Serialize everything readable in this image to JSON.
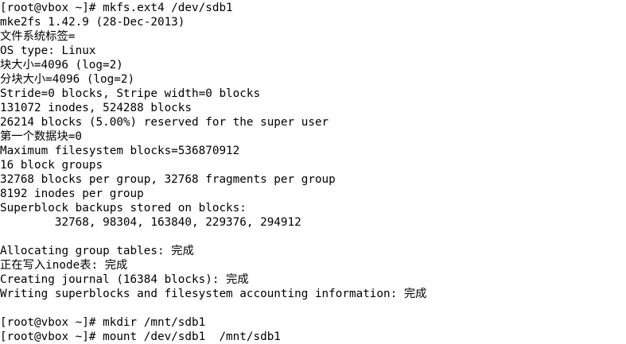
{
  "terminal": {
    "background": "#ffffff",
    "foreground": "#000000",
    "lines": [
      "[root@vbox ~]# mkfs.ext4 /dev/sdb1",
      "mke2fs 1.42.9 (28-Dec-2013)",
      "文件系统标签=",
      "OS type: Linux",
      "块大小=4096 (log=2)",
      "分块大小=4096 (log=2)",
      "Stride=0 blocks, Stripe width=0 blocks",
      "131072 inodes, 524288 blocks",
      "26214 blocks (5.00%) reserved for the super user",
      "第一个数据块=0",
      "Maximum filesystem blocks=536870912",
      "16 block groups",
      "32768 blocks per group, 32768 fragments per group",
      "8192 inodes per group",
      "Superblock backups stored on blocks:",
      "        32768, 98304, 163840, 229376, 294912",
      "",
      "Allocating group tables: 完成",
      "正在写入inode表: 完成",
      "Creating journal (16384 blocks): 完成",
      "Writing superblocks and filesystem accounting information: 完成",
      "",
      "[root@vbox ~]# mkdir /mnt/sdb1",
      "[root@vbox ~]# mount /dev/sdb1  /mnt/sdb1"
    ]
  }
}
